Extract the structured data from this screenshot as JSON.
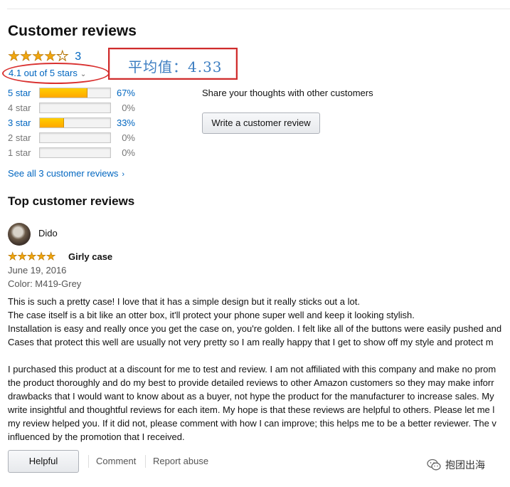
{
  "heading": "Customer reviews",
  "rating": {
    "stars": 4.1,
    "count": "3",
    "summary": "4.1 out of 5 stars"
  },
  "annotation": {
    "text": "平均值：4.33"
  },
  "histogram": [
    {
      "label": "5 star",
      "percent": 67,
      "percent_text": "67%",
      "linked": true
    },
    {
      "label": "4 star",
      "percent": 0,
      "percent_text": "0%",
      "linked": false
    },
    {
      "label": "3 star",
      "percent": 33,
      "percent_text": "33%",
      "linked": true
    },
    {
      "label": "2 star",
      "percent": 0,
      "percent_text": "0%",
      "linked": false
    },
    {
      "label": "1 star",
      "percent": 0,
      "percent_text": "0%",
      "linked": false
    }
  ],
  "share": {
    "text": "Share your thoughts with other customers",
    "button": "Write a customer review"
  },
  "see_all": "See all 3 customer reviews",
  "top_heading": "Top customer reviews",
  "review": {
    "reviewer": "Dido",
    "stars": 5,
    "title": "Girly case",
    "date": "June 19, 2016",
    "color": "Color: M419-Grey",
    "body": [
      "This is such a pretty case! I love that it has a simple design but it really sticks out a lot.",
      "The case itself is a bit like an otter box, it'll protect your phone super well and keep it looking stylish.",
      "Installation is easy and really once you get the case on, you're golden. I felt like all of the buttons were easily pushed and",
      "Cases that protect this well are usually not very pretty so I am really happy that I get to show off my style and protect m",
      "",
      "I purchased this product at a discount for me to test and review. I am not affiliated with this company and make no prom",
      "the product thoroughly and do my best to provide detailed reviews to other Amazon customers so they may make inforr",
      "drawbacks that I would want to know about as a buyer, not hype the product for the manufacturer to increase sales. My",
      "write insightful and thoughtful reviews for each item. My hope is that these reviews are helpful to others. Please let me l",
      "my review helped you. If it did not, please comment with how I can improve; this helps me to be a better reviewer. The v",
      "influenced by the promotion that I received."
    ],
    "actions": {
      "helpful": "Helpful",
      "comment": "Comment",
      "report": "Report abuse"
    }
  },
  "watermark": "抱团出海",
  "colors": {
    "link": "#0066c0",
    "star": "#f0a60f",
    "annotation_red": "#d9302f",
    "annotation_blue": "#3d7ec1"
  }
}
